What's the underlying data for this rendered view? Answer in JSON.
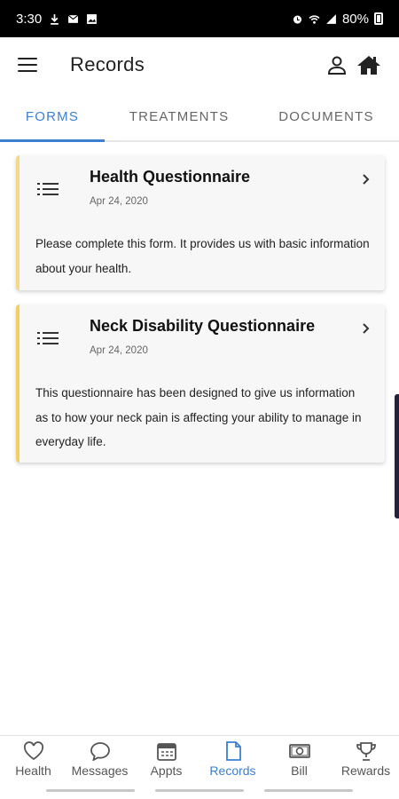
{
  "status_bar": {
    "time": "3:30",
    "battery": "80%"
  },
  "app_bar": {
    "title": "Records"
  },
  "tabs": [
    {
      "label": "FORMS",
      "active": true
    },
    {
      "label": "TREATMENTS",
      "active": false
    },
    {
      "label": "DOCUMENTS",
      "active": false
    }
  ],
  "forms": [
    {
      "title": "Health Questionnaire",
      "date": "Apr 24, 2020",
      "description": "Please complete this form. It provides us with basic information about your health."
    },
    {
      "title": "Neck Disability Questionnaire",
      "date": "Apr 24, 2020",
      "description": "This questionnaire has been designed to give us information as to how your neck pain is affecting your ability to manage in everyday life."
    }
  ],
  "bottom_nav": [
    {
      "label": "Health",
      "icon": "heart-icon"
    },
    {
      "label": "Messages",
      "icon": "chat-bubble-icon"
    },
    {
      "label": "Appts",
      "icon": "calendar-icon"
    },
    {
      "label": "Records",
      "icon": "document-icon",
      "active": true
    },
    {
      "label": "Bill",
      "icon": "money-icon"
    },
    {
      "label": "Rewards",
      "icon": "trophy-icon"
    }
  ],
  "colors": {
    "accent": "#3b7fd0",
    "card_border": "#f5d98a",
    "card_bg": "#f7f7f7"
  }
}
